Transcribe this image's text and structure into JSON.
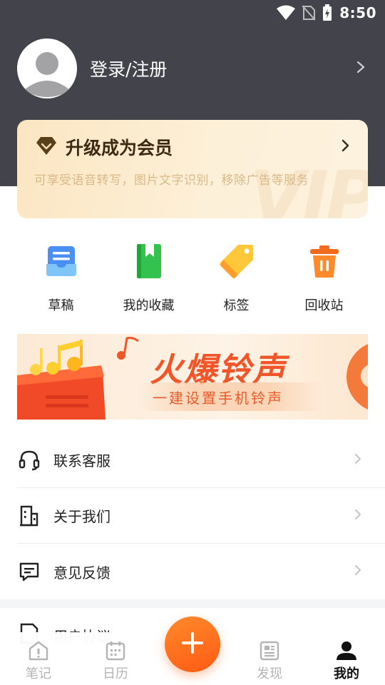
{
  "status_bar": {
    "time": "8:50",
    "icons": [
      "wifi-icon",
      "no-sim-icon",
      "battery-charging-icon"
    ]
  },
  "profile": {
    "login_label": "登录/注册",
    "avatar_icon": "user-avatar-icon",
    "chevron_icon": "chevron-right-icon"
  },
  "vip": {
    "title": "升级成为会员",
    "description": "可享受语音转写，图片文字识别，移除广告等服务",
    "watermark": "VIP",
    "icon": "diamond-icon"
  },
  "shortcuts": [
    {
      "label": "草稿",
      "icon": "draft-box-icon"
    },
    {
      "label": "我的收藏",
      "icon": "bookmark-book-icon"
    },
    {
      "label": "标签",
      "icon": "tag-icon"
    },
    {
      "label": "回收站",
      "icon": "trash-bin-icon"
    }
  ],
  "banner": {
    "title": "火爆铃声",
    "subtitle": "一建设置手机铃声"
  },
  "menu": [
    {
      "label": "联系客服",
      "icon": "headset-icon"
    },
    {
      "label": "关于我们",
      "icon": "building-icon"
    },
    {
      "label": "意见反馈",
      "icon": "feedback-message-icon"
    }
  ],
  "partial_menu": {
    "label": "用户协议",
    "icon": "agreement-icon"
  },
  "bottom_nav": [
    {
      "label": "笔记",
      "icon": "note-home-icon",
      "active": false
    },
    {
      "label": "日历",
      "icon": "calendar-icon",
      "active": false
    },
    {
      "label": "",
      "icon": "plus-icon",
      "active": false
    },
    {
      "label": "发现",
      "icon": "news-icon",
      "active": false
    },
    {
      "label": "我的",
      "icon": "person-icon",
      "active": true
    }
  ],
  "colors": {
    "header_bg": "#43444b",
    "accent_orange": "#ff6a1a",
    "vip_gold": "#fbe6c2",
    "active_nav": "#111111",
    "inactive_nav": "#b4b4b4"
  }
}
